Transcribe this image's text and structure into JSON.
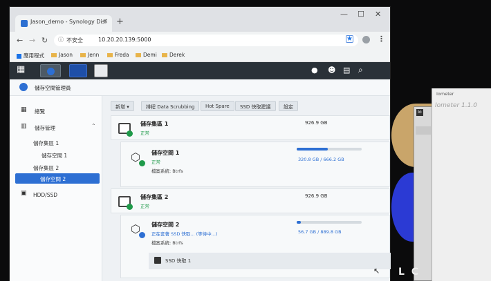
{
  "browser": {
    "tab_title": "Jason_demo - Synology DiskSt",
    "tab_close": "×",
    "new_tab": "+",
    "minimize": "—",
    "maximize": "☐",
    "close": "✕",
    "security_label": "不安全",
    "url": "10.20.20.139:5000",
    "bookmarks": [
      "應用程式",
      "Jason",
      "Jenn",
      "Freda",
      "Demi",
      "Derek"
    ]
  },
  "app": {
    "title": "儲存空間管理員",
    "sidebar": {
      "overview": "總覽",
      "storage_manager": "儲存管理",
      "pool1": "儲存集區 1",
      "volume1": "儲存空間 1",
      "pool2": "儲存集區 2",
      "volume2": "儲存空間 2",
      "hdd": "HDD/SSD"
    },
    "toolbar": {
      "new": "新增",
      "scrubbing": "排程 Data Scrubbing",
      "hot_spare": "Hot Spare",
      "ssd_advice": "SSD 快取建議",
      "settings": "設定"
    },
    "pool1": {
      "name": "儲存集區 1",
      "status": "正常",
      "capacity": "926.9 GB"
    },
    "volume1": {
      "name": "儲存空間 1",
      "status": "正常",
      "fs": "檔案系統: Btrfs",
      "usage": "320.8 GB / 666.2 GB",
      "fraction": 0.48
    },
    "pool2": {
      "name": "儲存集區 2",
      "status": "正常",
      "capacity": "926.9 GB"
    },
    "volume2": {
      "name": "儲存空間 2",
      "status": "正在套著 SSD 快取... (等待中...)",
      "fs": "檔案系統: Btrfs",
      "usage": "56.7 GB / 889.8 GB",
      "fraction": 0.06
    },
    "ssd_cache": "SSD 快取 1"
  },
  "iometer": {
    "title": "Iometer",
    "heading": "Iometer 1.1.0"
  },
  "colors": {
    "accent": "#2d6fd3",
    "ok": "#1f9a4a",
    "dsm_bar": "#2a3138"
  }
}
